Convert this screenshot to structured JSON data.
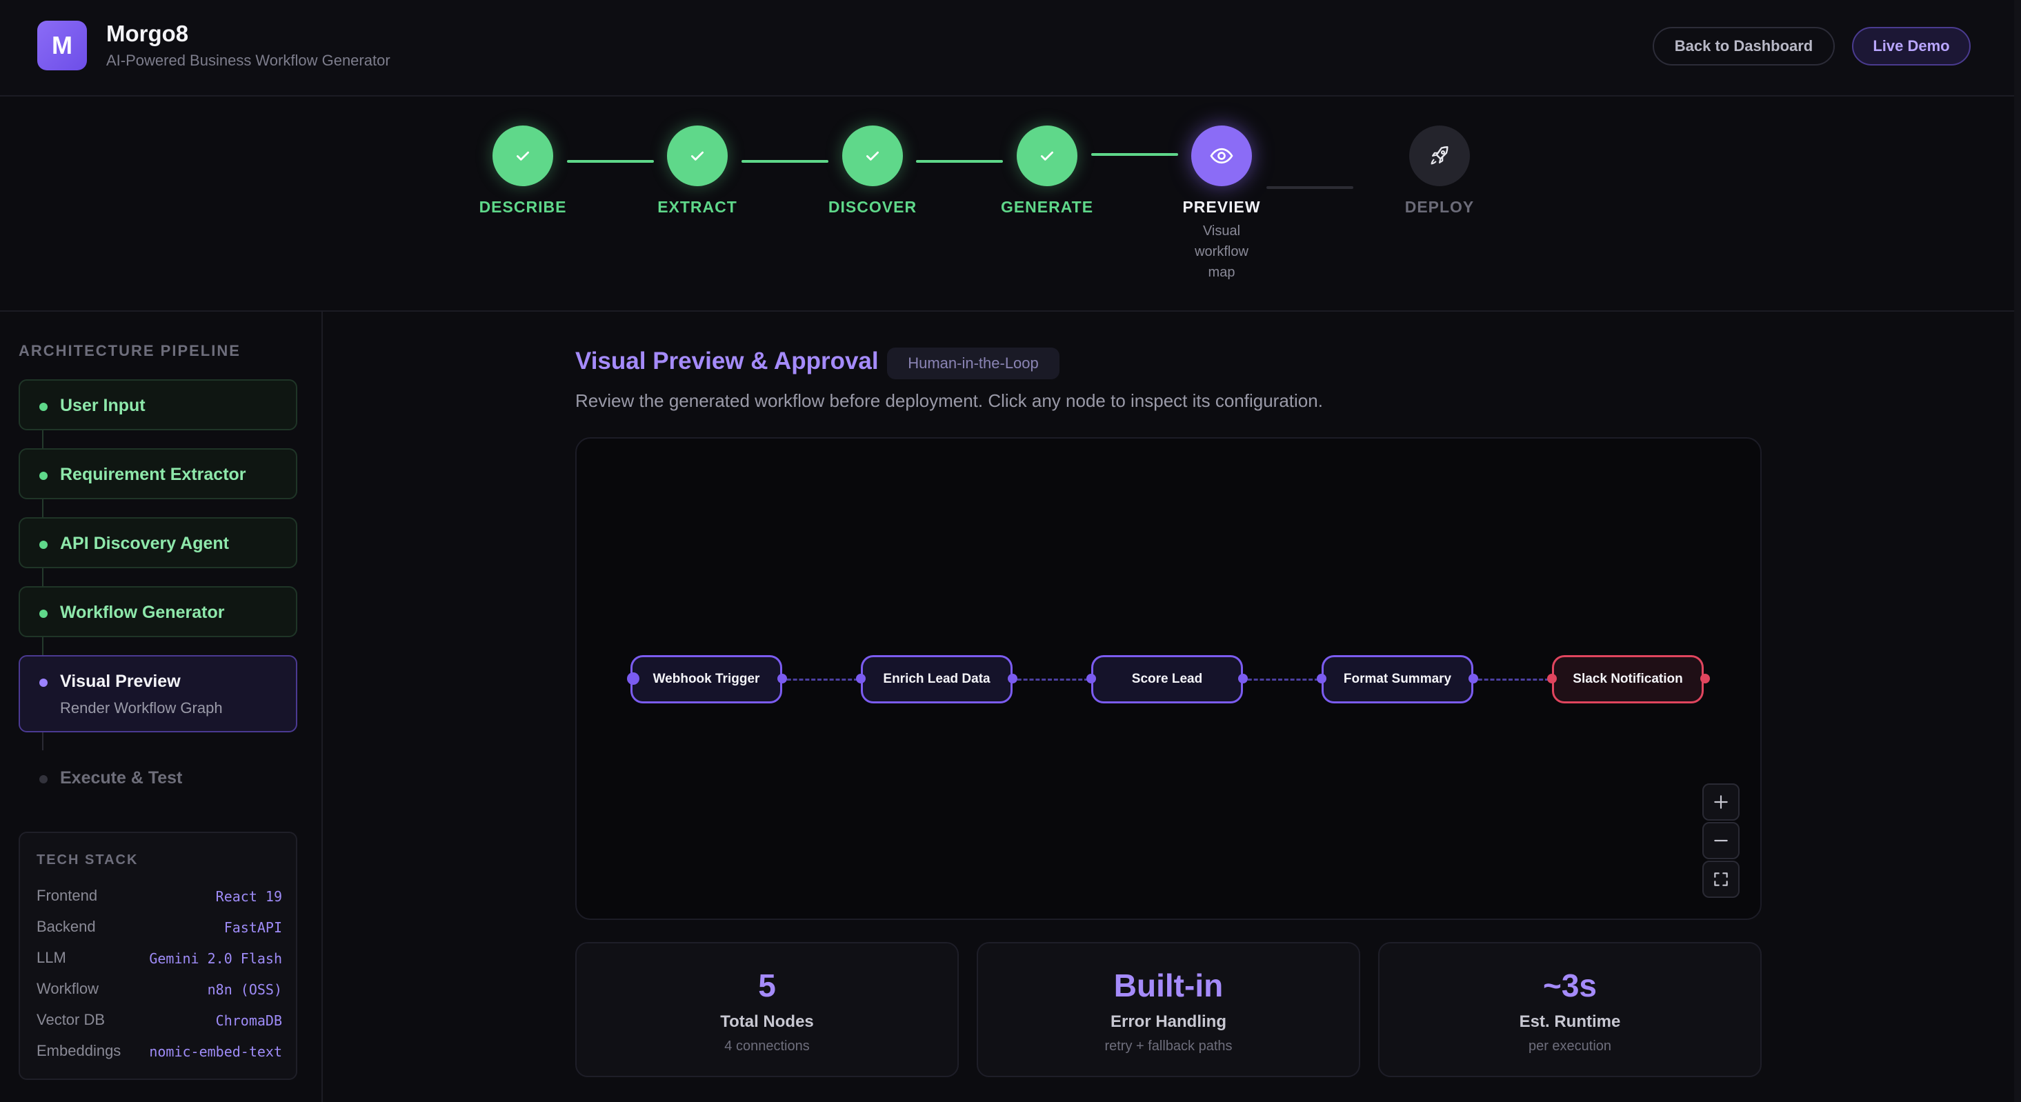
{
  "brand": {
    "initial": "M",
    "name": "Morgo8",
    "tagline": "AI-Powered Business Workflow Generator"
  },
  "header": {
    "back_label": "Back to Dashboard",
    "live_label": "Live Demo"
  },
  "steps": [
    {
      "label": "DESCRIBE",
      "state": "done",
      "icon": "check-icon"
    },
    {
      "label": "EXTRACT",
      "state": "done",
      "icon": "check-icon"
    },
    {
      "label": "DISCOVER",
      "state": "done",
      "icon": "check-icon"
    },
    {
      "label": "GENERATE",
      "state": "done",
      "icon": "check-icon"
    },
    {
      "label": "PREVIEW",
      "state": "active",
      "icon": "eye-icon",
      "desc": [
        "Visual",
        "workflow",
        "map"
      ]
    },
    {
      "label": "DEPLOY",
      "state": "pending",
      "icon": "rocket-icon"
    }
  ],
  "sidebar": {
    "title": "ARCHITECTURE PIPELINE",
    "items": [
      {
        "label": "User Input",
        "state": "done"
      },
      {
        "label": "Requirement Extractor",
        "state": "done"
      },
      {
        "label": "API Discovery Agent",
        "state": "done"
      },
      {
        "label": "Workflow Generator",
        "state": "done"
      },
      {
        "label": "Visual Preview",
        "state": "active",
        "sub": "Render Workflow Graph"
      },
      {
        "label": "Execute & Test",
        "state": "pending"
      }
    ],
    "tech_title": "TECH STACK",
    "tech": [
      {
        "key": "Frontend",
        "value": "React 19"
      },
      {
        "key": "Backend",
        "value": "FastAPI"
      },
      {
        "key": "LLM",
        "value": "Gemini 2.0 Flash"
      },
      {
        "key": "Workflow",
        "value": "n8n (OSS)"
      },
      {
        "key": "Vector DB",
        "value": "ChromaDB"
      },
      {
        "key": "Embeddings",
        "value": "nomic-embed-text"
      }
    ]
  },
  "main": {
    "title": "Visual Preview & Approval",
    "badge": "Human-in-the-Loop",
    "description": "Review the generated workflow before deployment. Click any node to inspect its configuration."
  },
  "workflow": {
    "nodes": [
      {
        "label": "Webhook Trigger",
        "variant": "normal"
      },
      {
        "label": "Enrich Lead Data",
        "variant": "normal"
      },
      {
        "label": "Score Lead",
        "variant": "normal"
      },
      {
        "label": "Format Summary",
        "variant": "normal"
      },
      {
        "label": "Slack Notification",
        "variant": "danger"
      }
    ],
    "controls": [
      "zoom-in-icon",
      "zoom-out-icon",
      "fit-view-icon"
    ]
  },
  "stats": [
    {
      "value": "5",
      "name": "Total Nodes",
      "note": "4 connections"
    },
    {
      "value": "Built-in",
      "name": "Error Handling",
      "note": "retry + fallback paths"
    },
    {
      "value": "~3s",
      "name": "Est. Runtime",
      "note": "per execution"
    }
  ],
  "colors": {
    "accent": "#8b6cf6",
    "success": "#5fd88a",
    "danger": "#e0455e",
    "background": "#0c0c10"
  }
}
